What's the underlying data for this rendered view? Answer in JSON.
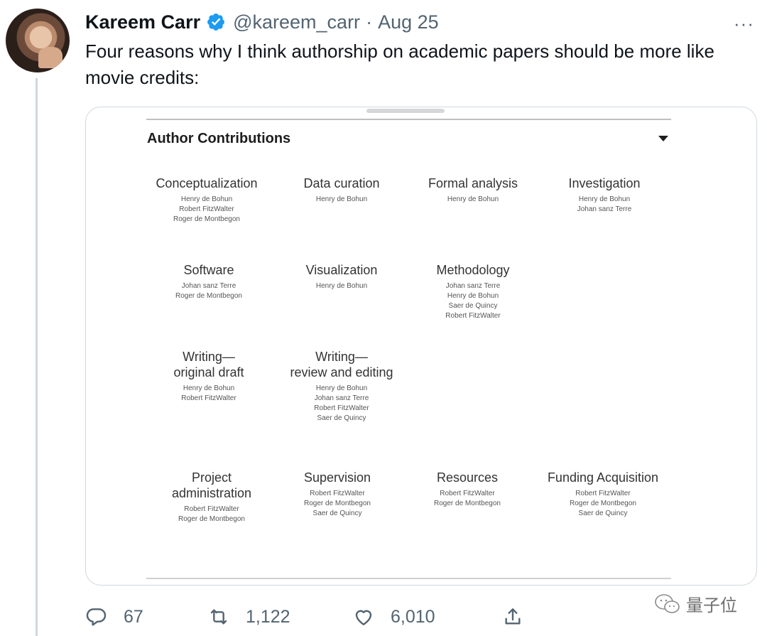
{
  "tweet": {
    "author_name": "Kareem Carr",
    "handle": "@kareem_carr",
    "separator": "·",
    "date": "Aug 25",
    "more_label": "···",
    "text": "Four reasons why I think authorship on academic papers should be more like movie credits:"
  },
  "image_card": {
    "title": "Author Contributions",
    "roles": [
      {
        "title": "Conceptualization",
        "people": [
          "Henry de Bohun",
          "Robert FitzWalter",
          "Roger de Montbegon"
        ]
      },
      {
        "title": "Data curation",
        "people": [
          "Henry de Bohun"
        ]
      },
      {
        "title": "Formal analysis",
        "people": [
          "Henry de Bohun"
        ]
      },
      {
        "title": "Investigation",
        "people": [
          "Henry de Bohun",
          "Johan sanz Terre"
        ]
      },
      {
        "title": "Software",
        "people": [
          "Johan sanz Terre",
          "Roger de Montbegon"
        ]
      },
      {
        "title": "Visualization",
        "people": [
          "Henry de Bohun"
        ]
      },
      {
        "title": "Methodology",
        "people": [
          "Johan sanz Terre",
          "Henry de Bohun",
          "Saer de Quincy",
          "Robert FitzWalter"
        ]
      },
      {
        "title_line1": "Writing—",
        "title_line2": "original draft",
        "people": [
          "Henry de Bohun",
          "Robert FitzWalter"
        ]
      },
      {
        "title_line1": "Writing—",
        "title_line2": "review and editing",
        "people": [
          "Henry de Bohun",
          "Johan sanz Terre",
          "Robert FitzWalter",
          "Saer de Quincy"
        ]
      },
      {
        "title_line1": "Project",
        "title_line2": "administration",
        "people": [
          "Robert FitzWalter",
          "Roger de Montbegon"
        ]
      },
      {
        "title": "Supervision",
        "people": [
          "Robert FitzWalter",
          "Roger de Montbegon",
          "Saer de Quincy"
        ]
      },
      {
        "title": "Resources",
        "people": [
          "Robert FitzWalter",
          "Roger de Montbegon"
        ]
      },
      {
        "title": "Funding Acquisition",
        "people": [
          "Robert FitzWalter",
          "Roger de Montbegon",
          "Saer de Quincy"
        ]
      }
    ]
  },
  "actions": {
    "reply_count": "67",
    "retweet_count": "1,122",
    "like_count": "6,010"
  },
  "icons": {
    "verified": "verified-badge-icon",
    "reply": "reply-icon",
    "retweet": "retweet-icon",
    "like": "heart-icon",
    "share": "share-icon",
    "watermark": "wechat-icon"
  },
  "colors": {
    "verified": "#1d9bf0",
    "secondary_text": "#536471",
    "border": "#cfd9de"
  },
  "watermark": {
    "text": "量子位"
  }
}
